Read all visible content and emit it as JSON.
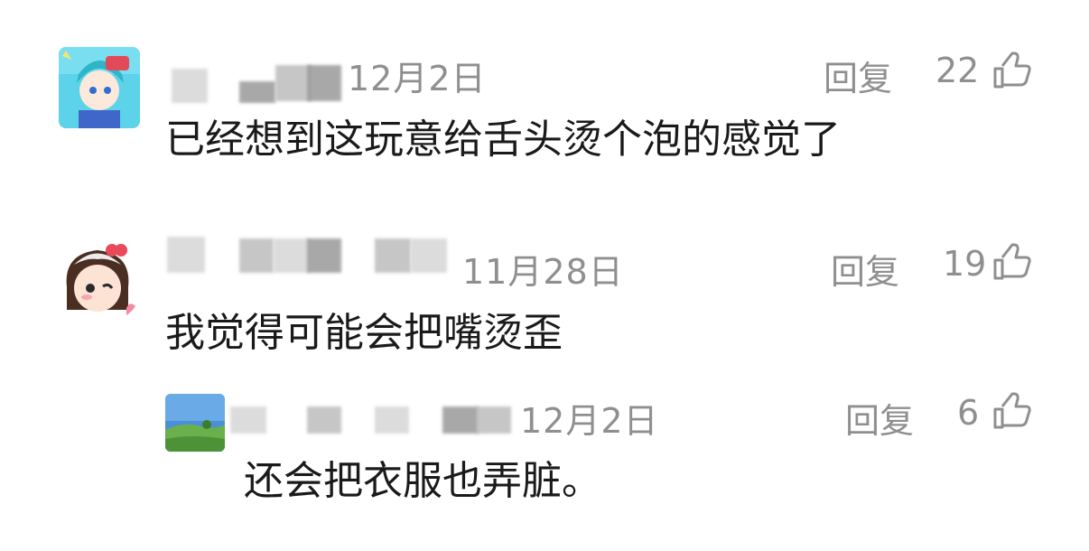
{
  "comments": [
    {
      "date": "12月2日",
      "reply_label": "回复",
      "likes": "22",
      "text": "已经想到这玩意给舌头烫个泡的感觉了"
    },
    {
      "date": "11月28日",
      "reply_label": "回复",
      "likes": "19",
      "text": "我觉得可能会把嘴烫歪"
    },
    {
      "date": "12月2日",
      "reply_label": "回复",
      "likes": "6",
      "text": "还会把衣服也弄脏。"
    }
  ],
  "icons": {
    "like": "thumb-up-icon"
  },
  "colors": {
    "meta_text": "#8f8f8f",
    "body_text": "#1a1a1a"
  }
}
